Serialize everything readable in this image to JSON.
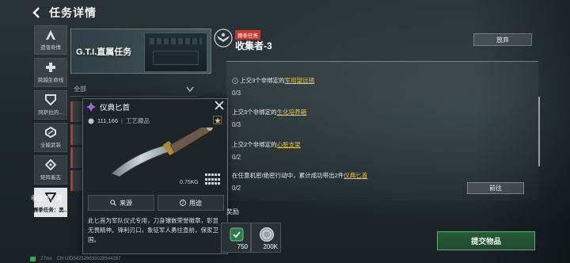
{
  "header": {
    "title": "任务详情",
    "back_icon": "chevron-left-icon"
  },
  "nav": [
    {
      "label": "遗落奇情",
      "icon": "a-emblem-icon",
      "active": false
    },
    {
      "label": "跨越生命线",
      "icon": "cross-icon",
      "active": false
    },
    {
      "label": "阿萨拉的...",
      "icon": "shield-icon",
      "active": false
    },
    {
      "label": "全能武装",
      "icon": "hex-icon",
      "active": false
    },
    {
      "label": "矩阵着志",
      "icon": "diamond-icon",
      "active": false
    },
    {
      "label": "赛季任务：黑...",
      "icon": "triangle-down-icon",
      "active": true
    }
  ],
  "center": {
    "category_title": "G.T.I.直属任务",
    "filter_value": "全部",
    "active_quest": "季任务：黑"
  },
  "tooltip": {
    "item_name": "仪典匕首",
    "price": "111,166",
    "category": "工艺藏品",
    "weight": "0.75KG",
    "source_button": "来源",
    "use_button": "用途",
    "description": "此匕首为军队仪式专用，刀身镶嵌荣誉徽章，彰显无畏精神。锋利刃口，象征军人勇往直前，保家卫国。"
  },
  "mission": {
    "badge": "赛季任务",
    "title": "收集者-3",
    "abandon_label": "放弃",
    "objectives": [
      {
        "prefix": "上交3个非绑定的",
        "highlight": "军用望远镜",
        "suffix": "",
        "progress": "0/3"
      },
      {
        "prefix": "上交3个非绑定的",
        "highlight": "生化培养箱",
        "suffix": "",
        "progress": "0/3"
      },
      {
        "prefix": "上交2个非绑定的",
        "highlight": "心脏支架",
        "suffix": "",
        "progress": "0/2"
      },
      {
        "prefix": "在任意机密/绝密行动中，累计成功带出2件",
        "highlight": "仪典匕首",
        "suffix": "",
        "progress": "0/2"
      }
    ],
    "goto_label": "前往",
    "reward_label": "奖励",
    "rewards": [
      {
        "value": "750",
        "icon": "green-token-icon"
      },
      {
        "value": "200K",
        "icon": "silver-coin-icon"
      }
    ],
    "submit_label": "提交物品"
  },
  "status": {
    "ping": "27ms",
    "uid": "CN UID542529633028544297"
  },
  "colors": {
    "accent_red": "#c8372d",
    "highlight_yellow": "#e8c548",
    "submit_green": "#57b06c",
    "tooltip_purple": "#9b6cd6"
  }
}
